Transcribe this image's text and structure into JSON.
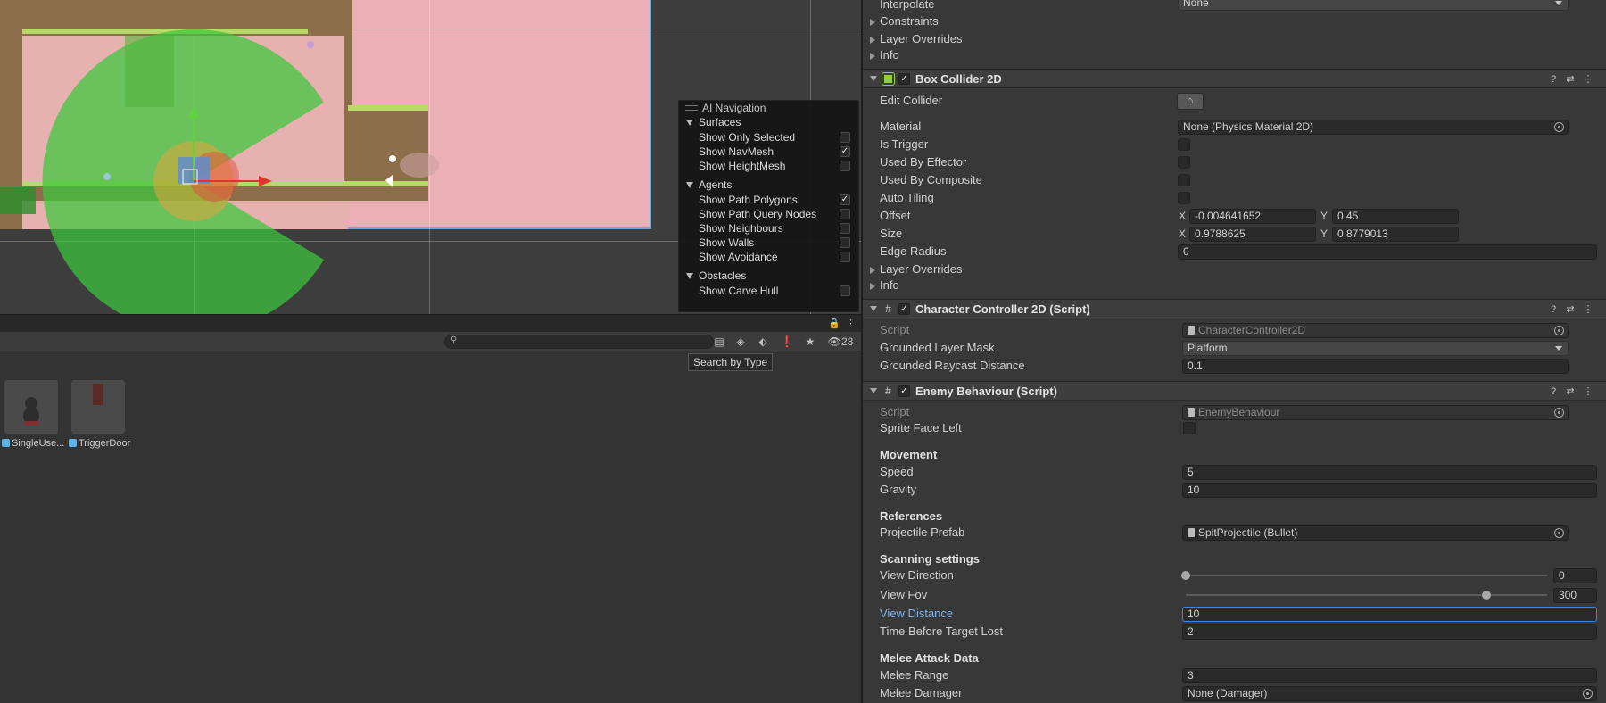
{
  "ai_navigation": {
    "title": "AI Navigation",
    "sections": [
      {
        "name": "Surfaces",
        "items": [
          {
            "label": "Show Only Selected",
            "checked": false
          },
          {
            "label": "Show NavMesh",
            "checked": true
          },
          {
            "label": "Show HeightMesh",
            "checked": false
          }
        ]
      },
      {
        "name": "Agents",
        "items": [
          {
            "label": "Show Path Polygons",
            "checked": true
          },
          {
            "label": "Show Path Query Nodes",
            "checked": false
          },
          {
            "label": "Show Neighbours",
            "checked": false
          },
          {
            "label": "Show Walls",
            "checked": false
          },
          {
            "label": "Show Avoidance",
            "checked": false
          }
        ]
      },
      {
        "name": "Obstacles",
        "items": [
          {
            "label": "Show Carve Hull",
            "checked": false
          }
        ]
      }
    ]
  },
  "project": {
    "hidden_count": "23",
    "tooltip": "Search by Type",
    "assets": [
      {
        "label": "SingleUse..."
      },
      {
        "label": "TriggerDoor"
      }
    ]
  },
  "inspector": {
    "rigidbody_tail": {
      "interpolate_label": "Interpolate",
      "interpolate_value": "None",
      "constraints": "Constraints",
      "layer_overrides": "Layer Overrides",
      "info": "Info"
    },
    "box_collider": {
      "title": "Box Collider 2D",
      "edit_collider": "Edit Collider",
      "material_label": "Material",
      "material_value": "None (Physics Material 2D)",
      "is_trigger": "Is Trigger",
      "used_by_effector": "Used By Effector",
      "used_by_composite": "Used By Composite",
      "auto_tiling": "Auto Tiling",
      "offset_label": "Offset",
      "offset_x": "-0.004641652",
      "offset_y": "0.45",
      "size_label": "Size",
      "size_x": "0.9788625",
      "size_y": "0.8779013",
      "edge_radius_label": "Edge Radius",
      "edge_radius_value": "0",
      "layer_overrides": "Layer Overrides",
      "info": "Info",
      "x": "X",
      "y": "Y"
    },
    "character_controller": {
      "title": "Character Controller 2D (Script)",
      "script_label": "Script",
      "script_value": "CharacterController2D",
      "grounded_mask_label": "Grounded Layer Mask",
      "grounded_mask_value": "Platform",
      "raycast_label": "Grounded Raycast Distance",
      "raycast_value": "0.1"
    },
    "enemy_behaviour": {
      "title": "Enemy Behaviour (Script)",
      "script_label": "Script",
      "script_value": "EnemyBehaviour",
      "sprite_face_left": "Sprite Face Left",
      "movement_header": "Movement",
      "speed_label": "Speed",
      "speed_value": "5",
      "gravity_label": "Gravity",
      "gravity_value": "10",
      "references_header": "References",
      "projectile_label": "Projectile Prefab",
      "projectile_value": "SpitProjectile (Bullet)",
      "scanning_header": "Scanning settings",
      "view_direction_label": "View Direction",
      "view_direction_value": "0",
      "view_direction_fraction": 0.0,
      "view_fov_label": "View Fov",
      "view_fov_value": "300",
      "view_fov_fraction": 0.8333,
      "view_distance_label": "View Distance",
      "view_distance_value": "10",
      "time_before_lost_label": "Time Before Target Lost",
      "time_before_lost_value": "2",
      "melee_header": "Melee Attack Data",
      "melee_range_label": "Melee Range",
      "melee_range_value": "3",
      "melee_damager_label": "Melee Damager",
      "melee_damager_value": "None (Damager)"
    }
  },
  "colors": {
    "accent_blue": "#3d86d9",
    "navmesh_green": "#3cc83c",
    "scene_pink": "#eab0b6",
    "box_collider_icon": "#8fcf3f"
  }
}
